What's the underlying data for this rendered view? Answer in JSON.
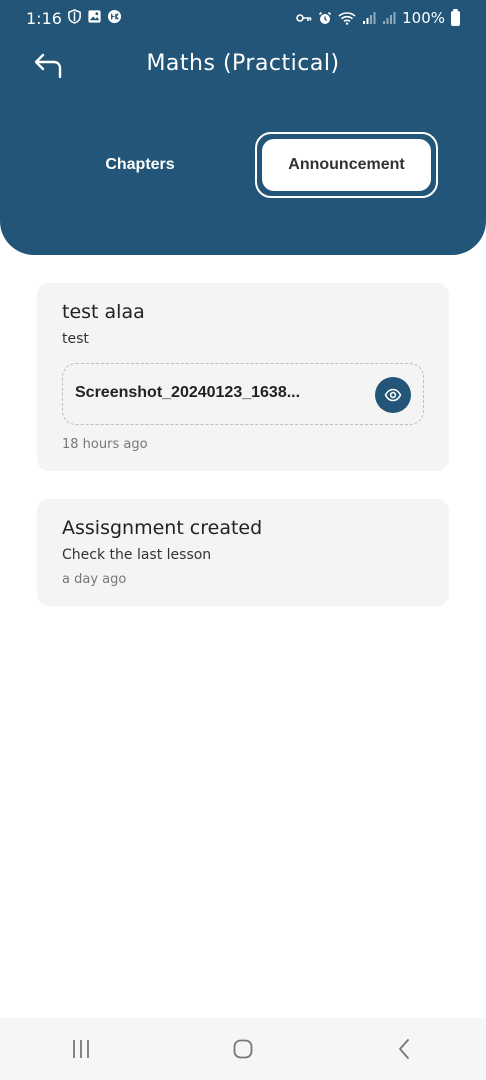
{
  "status_bar": {
    "time": "1:16",
    "battery": "100%",
    "left_icons": [
      "shield-icon",
      "image-icon",
      "notification-badge-icon"
    ],
    "right_icons": [
      "key-icon",
      "alarm-icon",
      "wifi-icon",
      "signal-icon",
      "signal-icon"
    ]
  },
  "header": {
    "title": "Maths (Practical)",
    "back_icon": "back-arrow-icon",
    "background_color": "#225577"
  },
  "tabs": [
    {
      "label": "Chapters",
      "active": false
    },
    {
      "label": "Announcement",
      "active": true
    }
  ],
  "announcements": [
    {
      "title": "test alaa",
      "body": "test",
      "attachment": {
        "name": "Screenshot_20240123_1638...",
        "action_icon": "eye-icon"
      },
      "time": "18 hours ago"
    },
    {
      "title": "Assisgnment created",
      "body": "Check the last lesson",
      "time": "a day ago"
    }
  ],
  "nav_bar": {
    "items": [
      "recent-apps-icon",
      "home-icon",
      "back-icon"
    ]
  }
}
